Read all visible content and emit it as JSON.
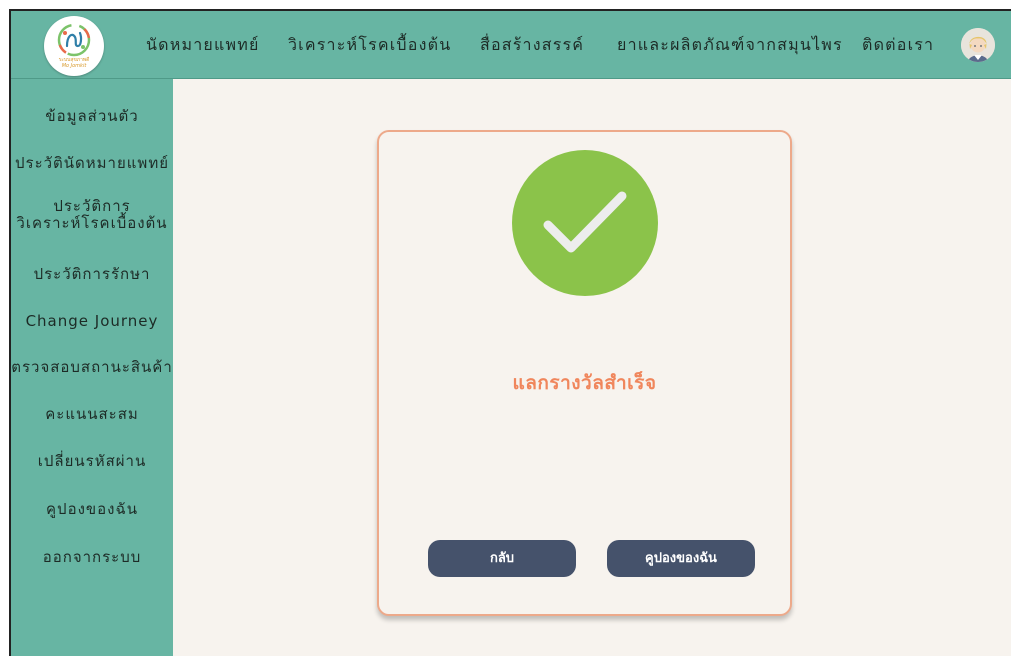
{
  "brand": {
    "logo_line1": "ระบบสุขภาพดี",
    "logo_line2": "Mo Jomkit"
  },
  "nav": {
    "items": [
      {
        "label": "นัดหมายแพทย์"
      },
      {
        "label": "วิเคราะห์โรคเบื้องต้น"
      },
      {
        "label": "สื่อสร้างสรรค์"
      },
      {
        "label": "ยาและผลิตภัณฑ์จากสมุนไพร"
      },
      {
        "label": "ติดต่อเรา"
      }
    ],
    "avatar_icon": "user-avatar"
  },
  "sidebar": {
    "items": [
      {
        "label": "ข้อมูลส่วนตัว"
      },
      {
        "label": "ประวัตินัดหมายแพทย์"
      },
      {
        "label": "ประวัติการ\nวิเคราะห์โรคเบื้องต้น"
      },
      {
        "label": "ประวัติการรักษา"
      },
      {
        "label": "Change Journey"
      },
      {
        "label": "ตรวจสอบสถานะสินค้า"
      },
      {
        "label": "คะแนนสะสม"
      },
      {
        "label": "เปลี่ยนรหัสผ่าน"
      },
      {
        "label": "คูปองของฉัน"
      },
      {
        "label": "ออกจากระบบ"
      }
    ]
  },
  "dialog": {
    "icon": "check-icon",
    "message": "แลกรางวัลสำเร็จ",
    "back_label": "กลับ",
    "coupon_label": "คูปองของฉัน"
  },
  "colors": {
    "nav_bg": "#67b5a3",
    "content_bg": "#f7f3ee",
    "success_green": "#8bc34a",
    "accent_orange": "#f0865c",
    "card_border": "#eda98a",
    "button_bg": "#45526b"
  }
}
